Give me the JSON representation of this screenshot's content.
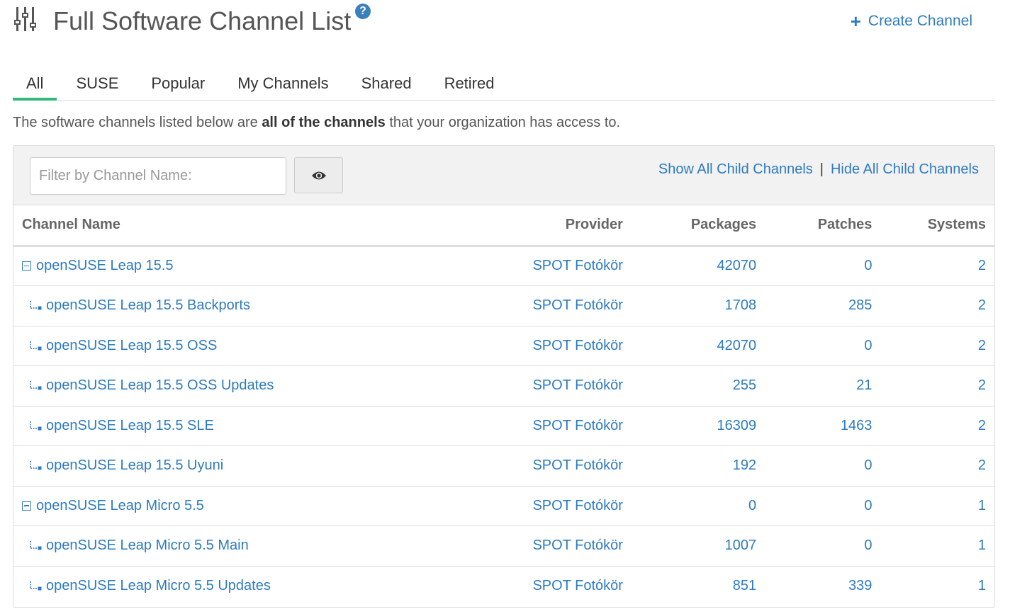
{
  "header": {
    "title": "Full Software Channel List",
    "help_icon": "question-circle-icon",
    "title_icon": "sliders-icon",
    "create_label": "Create Channel"
  },
  "tabs": [
    {
      "label": "All",
      "active": true
    },
    {
      "label": "SUSE",
      "active": false
    },
    {
      "label": "Popular",
      "active": false
    },
    {
      "label": "My Channels",
      "active": false
    },
    {
      "label": "Shared",
      "active": false
    },
    {
      "label": "Retired",
      "active": false
    }
  ],
  "description": {
    "before": "The software channels listed below are ",
    "bold": "all of the channels",
    "after": " that your organization has access to."
  },
  "toolbar": {
    "filter_placeholder": "Filter by Channel Name:",
    "filter_value": "",
    "show_all": "Show All Child Channels",
    "separator": "|",
    "hide_all": "Hide All Child Channels"
  },
  "table": {
    "headers": {
      "name": "Channel Name",
      "provider": "Provider",
      "packages": "Packages",
      "patches": "Patches",
      "systems": "Systems"
    },
    "rows": [
      {
        "name": "openSUSE Leap 15.5",
        "type": "parent",
        "provider": "SPOT Fotókör",
        "packages": "42070",
        "patches": "0",
        "systems": "2"
      },
      {
        "name": "openSUSE Leap 15.5 Backports",
        "type": "child",
        "provider": "SPOT Fotókör",
        "packages": "1708",
        "patches": "285",
        "systems": "2"
      },
      {
        "name": "openSUSE Leap 15.5 OSS",
        "type": "child",
        "provider": "SPOT Fotókör",
        "packages": "42070",
        "patches": "0",
        "systems": "2"
      },
      {
        "name": "openSUSE Leap 15.5 OSS Updates",
        "type": "child",
        "provider": "SPOT Fotókör",
        "packages": "255",
        "patches": "21",
        "systems": "2"
      },
      {
        "name": "openSUSE Leap 15.5 SLE",
        "type": "child",
        "provider": "SPOT Fotókör",
        "packages": "16309",
        "patches": "1463",
        "systems": "2"
      },
      {
        "name": "openSUSE Leap 15.5 Uyuni",
        "type": "child",
        "provider": "SPOT Fotókör",
        "packages": "192",
        "patches": "0",
        "systems": "2"
      },
      {
        "name": "openSUSE Leap Micro 5.5",
        "type": "parent",
        "provider": "SPOT Fotókör",
        "packages": "0",
        "patches": "0",
        "systems": "1"
      },
      {
        "name": "openSUSE Leap Micro 5.5 Main",
        "type": "child",
        "provider": "SPOT Fotókör",
        "packages": "1007",
        "patches": "0",
        "systems": "1"
      },
      {
        "name": "openSUSE Leap Micro 5.5 Updates",
        "type": "child",
        "provider": "SPOT Fotókör",
        "packages": "851",
        "patches": "339",
        "systems": "1"
      }
    ]
  },
  "colors": {
    "link": "#2e7bbf",
    "active_tab": "#30ba78",
    "help_icon": "#3a80bc"
  }
}
